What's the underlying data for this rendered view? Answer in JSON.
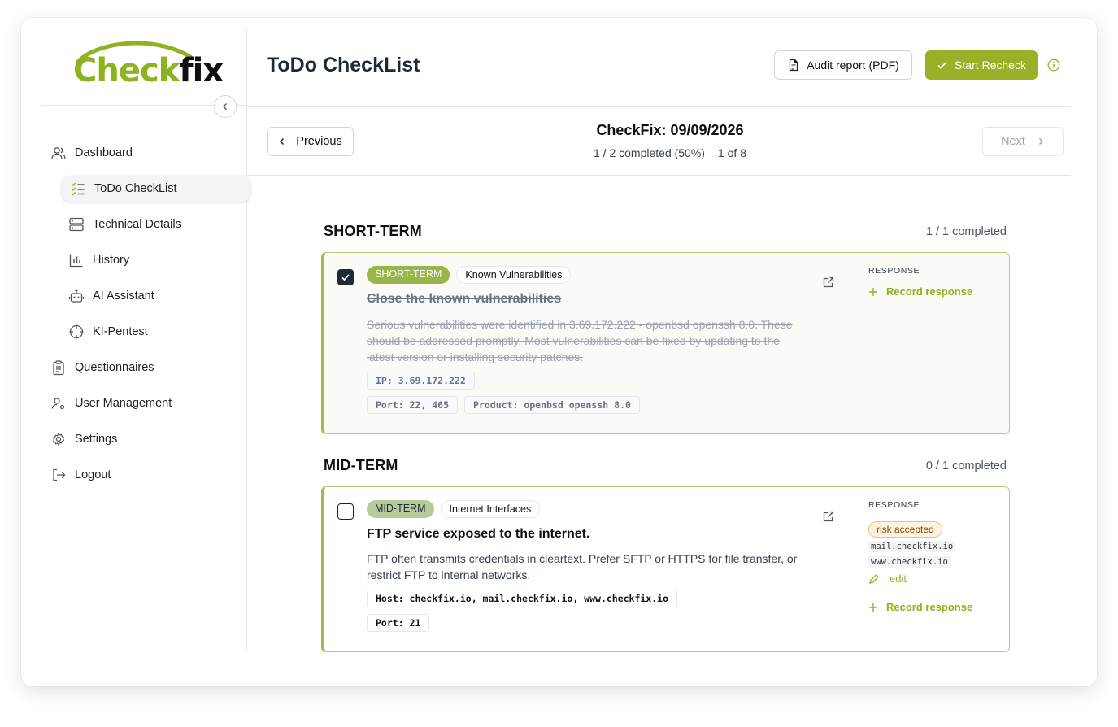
{
  "logo": {
    "part1": "Check",
    "part2": "fix"
  },
  "sidebar": {
    "items": [
      {
        "label": "Dashboard",
        "icon": "users-icon"
      },
      {
        "label": "ToDo CheckList",
        "icon": "checklist-icon",
        "active": true
      },
      {
        "label": "Technical Details",
        "icon": "server-icon"
      },
      {
        "label": "History",
        "icon": "bar-chart-icon"
      },
      {
        "label": "AI Assistant",
        "icon": "robot-icon"
      },
      {
        "label": "KI-Pentest",
        "icon": "crosshair-icon"
      },
      {
        "label": "Questionnaires",
        "icon": "clipboard-icon"
      },
      {
        "label": "User Management",
        "icon": "user-cog-icon"
      },
      {
        "label": "Settings",
        "icon": "gear-icon"
      },
      {
        "label": "Logout",
        "icon": "logout-icon"
      }
    ]
  },
  "header": {
    "title": "ToDo CheckList",
    "audit_label": "Audit report (PDF)",
    "recheck_label": "Start Recheck"
  },
  "subnav": {
    "prev_label": "Previous",
    "next_label": "Next",
    "title": "CheckFix: 09/09/2026",
    "progress": "1 / 2 completed (50%)",
    "position": "1 of 8"
  },
  "colors": {
    "accent": "#97b226",
    "card_border": "#a3b84f",
    "risk_badge": "#fef3e0"
  },
  "sections": [
    {
      "title": "SHORT-TERM",
      "count": "1 / 1 completed",
      "card": {
        "checked": true,
        "term_tag": "SHORT-TERM",
        "category_tag": "Known Vulnerabilities",
        "title": "Close the known vulnerabilities",
        "description": "Serious vulnerabilities were identified in 3.69.172.222 - openbsd openssh 8.0. These should be addressed promptly. Most vulnerabilities can be fixed by updating to the latest version or installing security patches.",
        "chips_row1": [
          "IP: 3.69.172.222"
        ],
        "chips_row2": [
          "Port: 22, 465",
          "Product: openbsd openssh 8.0"
        ],
        "response_label": "RESPONSE",
        "record_label": "Record response"
      }
    },
    {
      "title": "MID-TERM",
      "count": "0 / 1 completed",
      "card": {
        "checked": false,
        "term_tag": "MID-TERM",
        "category_tag": "Internet Interfaces",
        "title": "FTP service exposed to the internet.",
        "description": "FTP often transmits credentials in cleartext. Prefer SFTP or HTTPS for file transfer, or restrict FTP to internal networks.",
        "chips_row1": [
          "Host: checkfix.io, mail.checkfix.io, www.checkfix.io"
        ],
        "chips_row2": [
          "Port: 21"
        ],
        "response_label": "RESPONSE",
        "risk_badge": "risk accepted",
        "hosts": [
          "mail.checkfix.io",
          "www.checkfix.io"
        ],
        "edit_label": "edit",
        "record_label": "Record response"
      }
    }
  ]
}
